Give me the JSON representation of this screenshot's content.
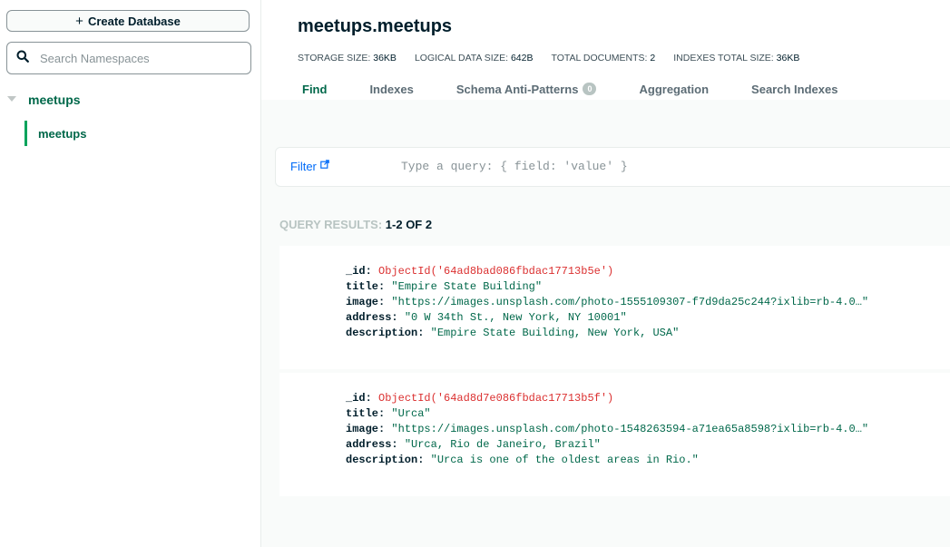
{
  "sidebar": {
    "create_label": "Create Database",
    "search_placeholder": "Search Namespaces",
    "database": "meetups",
    "collection": "meetups"
  },
  "header": {
    "title": "meetups.meetups",
    "stats": [
      {
        "label": "STORAGE SIZE:",
        "value": "36KB"
      },
      {
        "label": "LOGICAL DATA SIZE:",
        "value": "642B"
      },
      {
        "label": "TOTAL DOCUMENTS:",
        "value": "2"
      },
      {
        "label": "INDEXES TOTAL SIZE:",
        "value": "36KB"
      }
    ],
    "tabs": [
      {
        "label": "Find",
        "active": true
      },
      {
        "label": "Indexes"
      },
      {
        "label": "Schema Anti-Patterns",
        "badge": "0"
      },
      {
        "label": "Aggregation"
      },
      {
        "label": "Search Indexes"
      }
    ]
  },
  "filter": {
    "label": "Filter",
    "placeholder": "Type a query: { field: 'value' }"
  },
  "results": {
    "label": "QUERY RESULTS:",
    "count": "1-2 OF 2"
  },
  "documents": [
    {
      "id": "ObjectId('64ad8bad086fbdac17713b5e')",
      "title": "\"Empire State Building\"",
      "image": "\"https://images.unsplash.com/photo-1555109307-f7d9da25c244?ixlib=rb-4.0…\"",
      "address": "\"0 W 34th St., New York, NY 10001\"",
      "description": "\"Empire State Building, New York, USA\""
    },
    {
      "id": "ObjectId('64ad8d7e086fbdac17713b5f')",
      "title": "\"Urca\"",
      "image": "\"https://images.unsplash.com/photo-1548263594-a71ea65a8598?ixlib=rb-4.0…\"",
      "address": "\"Urca, Rio de Janeiro, Brazil\"",
      "description": "\"Urca is one of the oldest areas in Rio.\""
    }
  ],
  "field_keys": {
    "id": "_id:",
    "title": "title:",
    "image": "image:",
    "address": "address:",
    "description": "description:"
  },
  "colors": {
    "accent_green": "#00684a",
    "bar_green": "#00a35c",
    "link_blue": "#016bf8",
    "objectid_red": "#db3030"
  }
}
